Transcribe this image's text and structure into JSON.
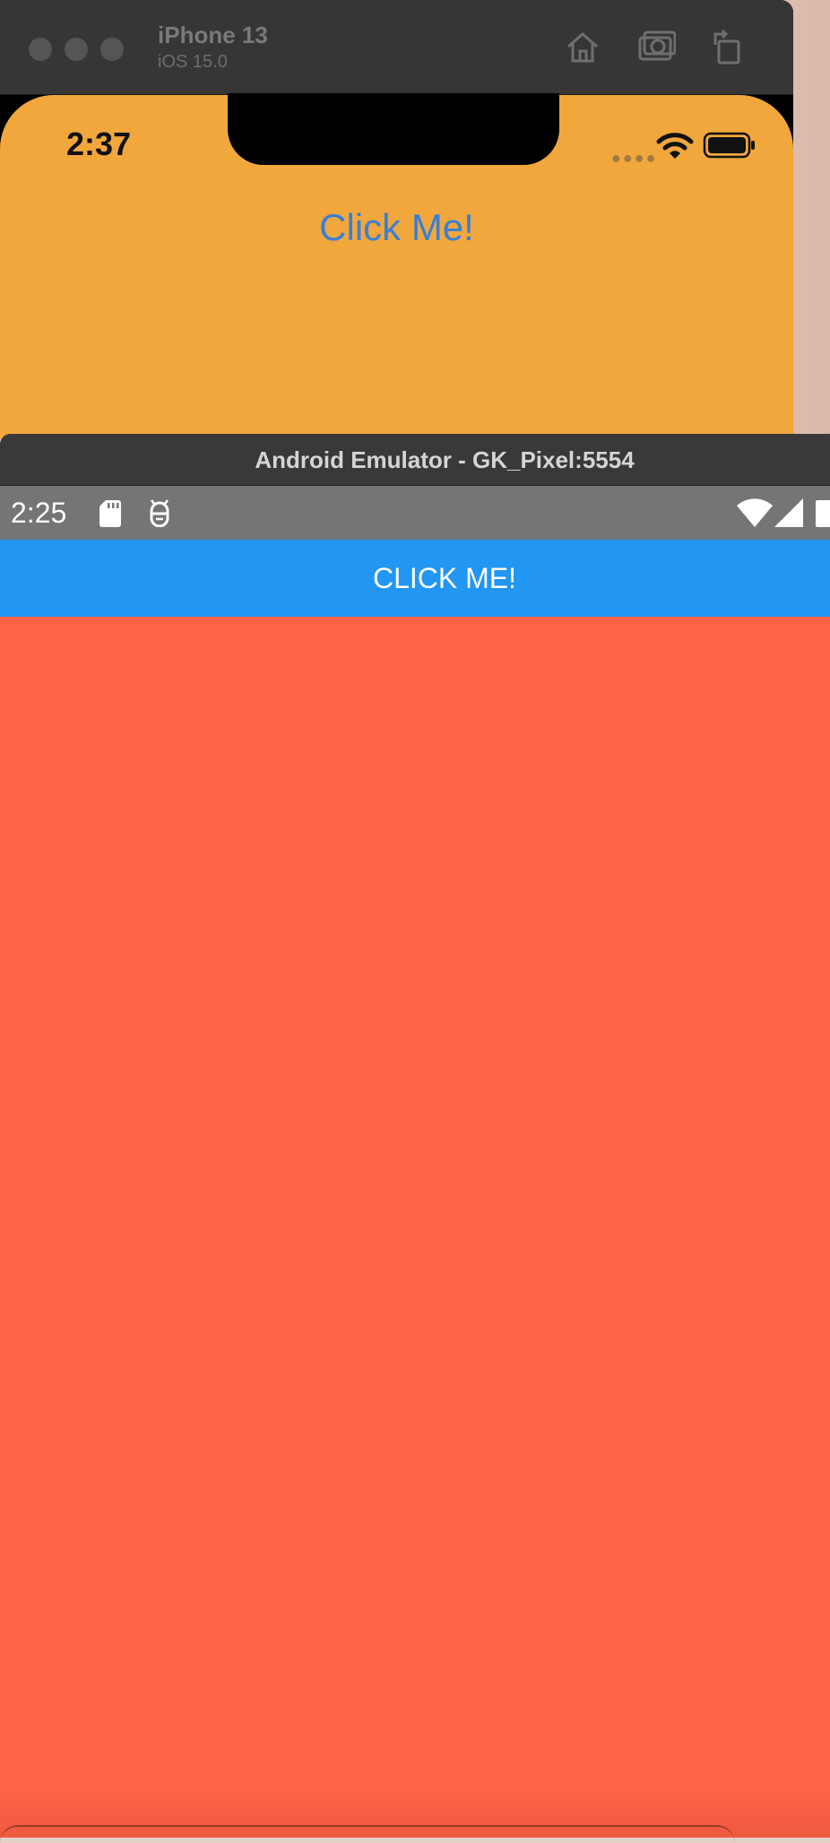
{
  "ios_simulator": {
    "device_name": "iPhone 13",
    "os_version": "iOS 15.0",
    "toolbar_icons": [
      "home-icon",
      "screenshot-icon",
      "rotate-icon"
    ],
    "status_time": "2:37",
    "button_label": "Click Me!",
    "background_color": "#f1a73c",
    "button_color": "#3a7fd6"
  },
  "android_emulator": {
    "window_title": "Android Emulator - GK_Pixel:5554",
    "status_time": "2:25",
    "status_icons": [
      "sd-card-icon",
      "android-debug-icon",
      "wifi-icon",
      "signal-icon",
      "battery-icon"
    ],
    "button_label": "CLICK ME!",
    "appbar_color": "#2196f3",
    "body_color": "#ff6347"
  }
}
